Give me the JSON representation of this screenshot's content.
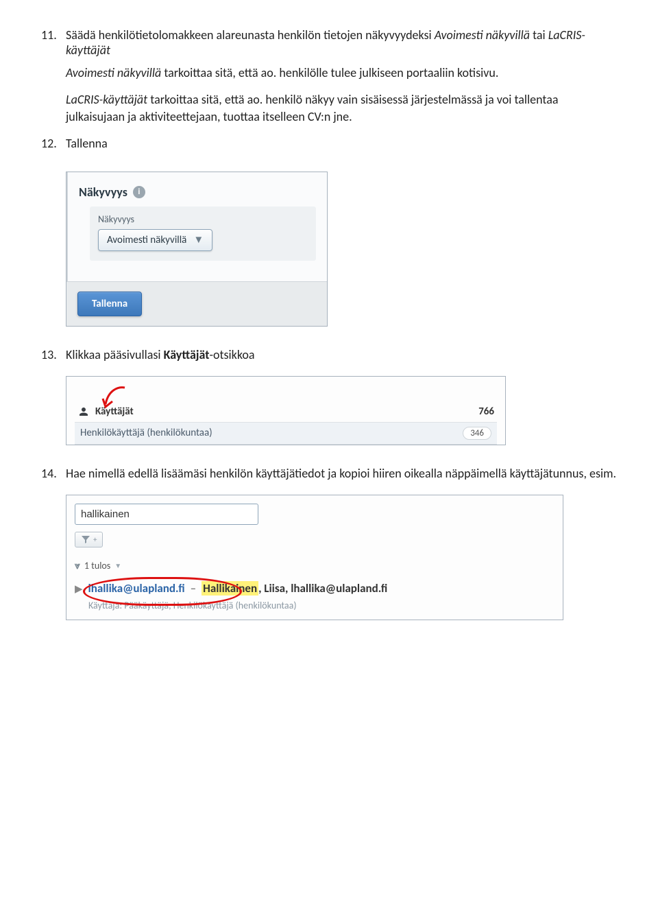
{
  "item11": {
    "num": "11.",
    "text_before_italic1": "Säädä henkilötietolomakkeen alareunasta henkilön tietojen näkyvyydeksi ",
    "italic1": "Avoimesti näkyvillä",
    "text_mid1": " tai ",
    "italic2": "LaCRIS-käyttäjät"
  },
  "para_a": {
    "italic": "Avoimesti näkyvillä",
    "rest": " tarkoittaa sitä, että ao. henkilölle tulee julkiseen portaaliin kotisivu."
  },
  "para_b": {
    "italic": "LaCRIS-käyttäjät",
    "rest": " tarkoittaa sitä, että ao. henkilö näkyy vain sisäisessä järjestelmässä ja voi tallentaa julkaisujaan ja aktiviteettejaan, tuottaa itselleen CV:n jne."
  },
  "item12": {
    "num": "12.",
    "text": "Tallenna"
  },
  "shot1": {
    "section_label": "Näkyvyys",
    "info_char": "i",
    "sub_label": "Näkyvyys",
    "select_value": "Avoimesti näkyvillä",
    "save_label": "Tallenna"
  },
  "item13": {
    "num": "13.",
    "text_before": "Klikkaa pääsivullasi ",
    "bold": "Käyttäjät",
    "text_after": "-otsikkoa"
  },
  "shot2": {
    "header": "Käyttäjät",
    "header_count": "766",
    "row1_label": "Henkilökäyttäjä (henkilökuntaa)",
    "row1_count": "346"
  },
  "item14": {
    "num": "14.",
    "text": "Hae nimellä edellä lisäämäsi henkilön käyttäjätiedot ja kopioi hiiren oikealla näppäimellä käyttäjätunnus, esim."
  },
  "shot3": {
    "search_value": "hallikainen",
    "tulos_label": "1 tulos",
    "user_link": "lhallika@ulapland.fi",
    "highlighted": "Hallikainen",
    "after_highlight": ", Liisa, lhallika@ulapland.fi",
    "sub_label": "Käyttäjä: Pääkäyttäjä, Henkilökäyttäjä (henkilökuntaa)"
  }
}
